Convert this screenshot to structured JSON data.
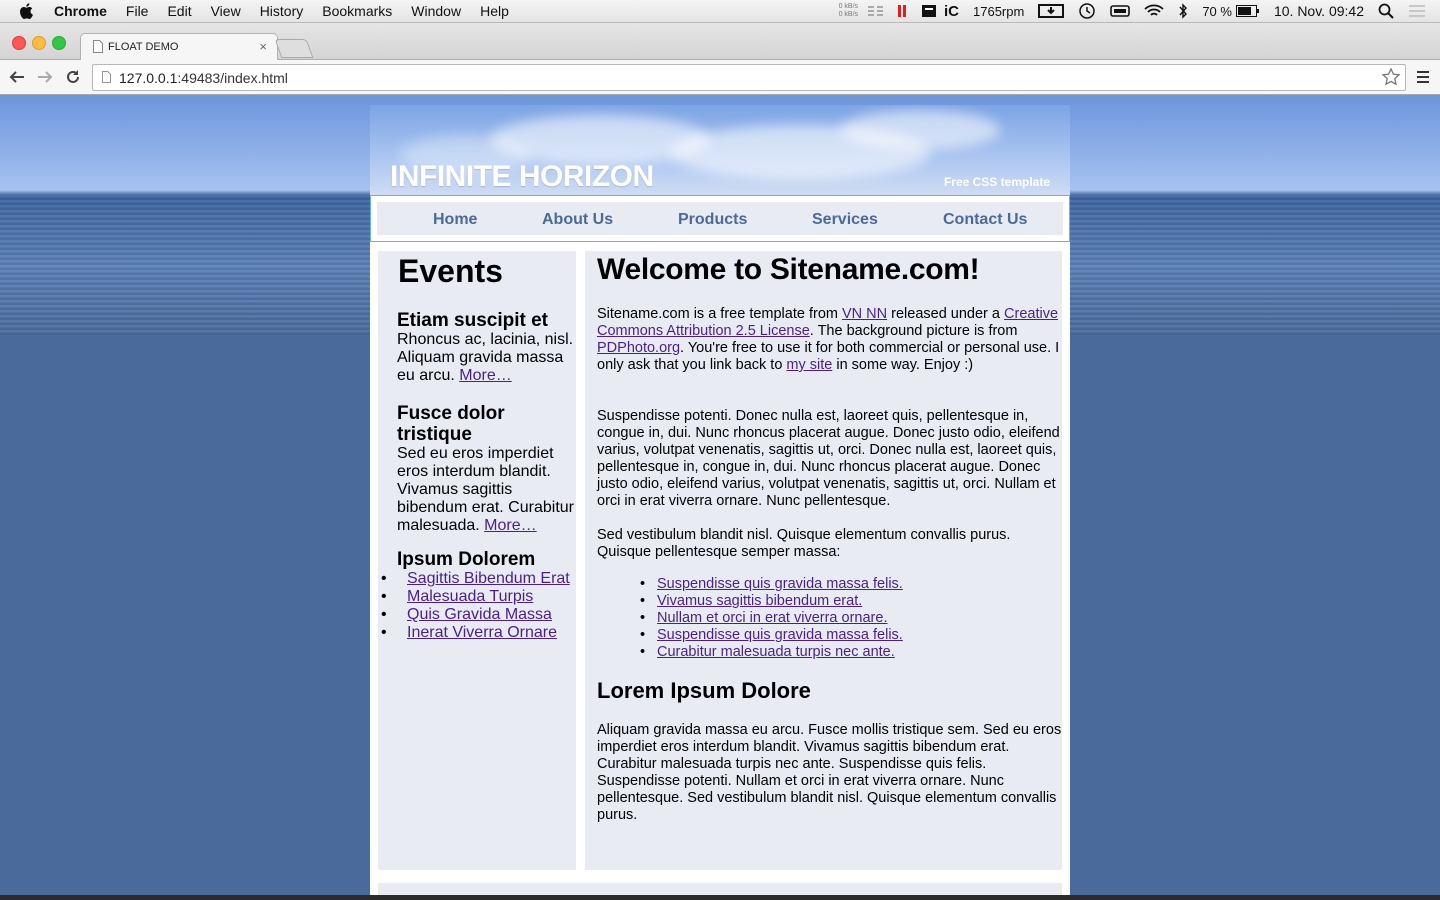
{
  "menubar": {
    "app_name": "Chrome",
    "items": [
      "File",
      "Edit",
      "View",
      "History",
      "Bookmarks",
      "Window",
      "Help"
    ],
    "net_up": "0 kB/s",
    "net_down": "0 kB/s",
    "fan_speed": "1765rpm",
    "battery": "70 %",
    "datetime": "10. Nov.  09:42"
  },
  "browser": {
    "tab_title": "FLOAT DEMO",
    "tab_close": "×",
    "url_host": "127.0.0.1",
    "url_path": ":49483/index.html"
  },
  "site": {
    "title": "INFINITE HORIZON",
    "tagline": "Free CSS template",
    "nav": [
      "Home",
      "About Us",
      "Products",
      "Services",
      "Contact Us"
    ]
  },
  "sidebar": {
    "heading": "Events",
    "block1": {
      "title": "Etiam suscipit et",
      "text": "Rhoncus ac, lacinia, nisl. Aliquam gravida massa eu arcu. ",
      "more": "More…"
    },
    "block2": {
      "title": "Fusce dolor tristique",
      "text": "Sed eu eros imperdiet eros interdum blandit. Vivamus sagittis bibendum erat. Curabitur malesuada. ",
      "more": "More…"
    },
    "list": {
      "title": "Ipsum Dolorem",
      "items": [
        "Sagittis Bibendum Erat",
        "Malesuada Turpis",
        "Quis Gravida Massa",
        "Inerat Viverra Ornare"
      ]
    }
  },
  "main": {
    "welcome": "Welcome to Sitename.com!",
    "p1": {
      "t1": "Sitename.com is a free template from ",
      "l1": "VN NN",
      "t2": " released under a ",
      "l2": "Creative Commons Attribution 2.5 License",
      "t3": ". The background picture is from ",
      "l3": "PDPhoto.org",
      "t4": ". You're free to use it for both commercial or personal use. I only ask that you link back to ",
      "l4": "my site",
      "t5": " in some way. Enjoy :)"
    },
    "p2": "Suspendisse potenti. Donec nulla est, laoreet quis, pellentesque in, congue in, dui. Nunc rhoncus placerat augue. Donec justo odio, eleifend varius, volutpat venenatis, sagittis ut, orci. Donec nulla est, laoreet quis, pellentesque in, congue in, dui. Nunc rhoncus placerat augue. Donec justo odio, eleifend varius, volutpat venenatis, sagittis ut, orci. Nullam et orci in erat viverra ornare. Nunc pellentesque.",
    "p3": "Sed vestibulum blandit nisl. Quisque elementum convallis purus. Quisque pellentesque semper massa:",
    "links": [
      "Suspendisse quis gravida massa felis.",
      "Vivamus sagittis bibendum erat.",
      "Nullam et orci in erat viverra ornare.",
      "Suspendisse quis gravida massa felis.",
      "Curabitur malesuada turpis nec ante."
    ],
    "lorem_title": "Lorem Ipsum Dolore",
    "p4": "Aliquam gravida massa eu arcu. Fusce mollis tristique sem. Sed eu eros imperdiet eros interdum blandit. Vivamus sagittis bibendum erat. Curabitur malesuada turpis nec ante. Suspendisse quis felis. Suspendisse potenti. Nullam et orci in erat viverra ornare. Nunc pellentesque. Sed vestibulum blandit nisl. Quisque elementum convallis purus."
  },
  "colors": {
    "link": "#4a1f8a",
    "nav_text": "#4a6a9c",
    "panel_bg": "#e8ecf2",
    "nav_border": "#64b4ea"
  }
}
